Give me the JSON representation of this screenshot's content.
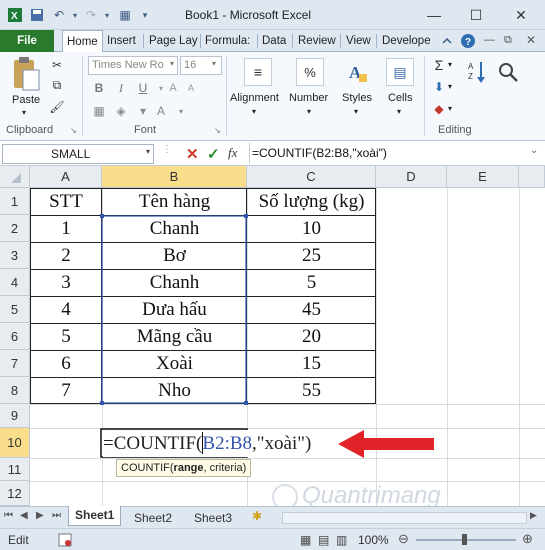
{
  "window": {
    "title": "Book1 - Microsoft Excel",
    "minimize": "—",
    "maximize": "☐",
    "close": "✕"
  },
  "tabs": [
    "File",
    "Home",
    "Insert",
    "Page Lay",
    "Formula:",
    "Data",
    "Review",
    "View",
    "Develope"
  ],
  "ribbon": {
    "paste_label": "Paste",
    "font_name": "Times New Ro",
    "font_size": "16",
    "alignment_label": "Alignment",
    "number_label": "Number",
    "styles_label": "Styles",
    "cells_label": "Cells",
    "clipboard_group": "Clipboard",
    "font_group": "Font",
    "editing_group": "Editing",
    "bold": "B",
    "italic": "I",
    "underline": "U",
    "sum": "Σ"
  },
  "formula_bar": {
    "name_box": "SMALL",
    "fx": "fx",
    "formula": "=COUNTIF(B2:B8,\"xoài\")"
  },
  "columns": [
    "A",
    "B",
    "C",
    "D",
    "E"
  ],
  "rows": [
    "1",
    "2",
    "3",
    "4",
    "5",
    "6",
    "7",
    "8",
    "9",
    "10",
    "11",
    "12"
  ],
  "table": {
    "headers": [
      "STT",
      "Tên hàng",
      "Số lượng (kg)"
    ],
    "rows": [
      [
        "1",
        "Chanh",
        "10"
      ],
      [
        "2",
        "Bơ",
        "25"
      ],
      [
        "3",
        "Chanh",
        "5"
      ],
      [
        "4",
        "Dưa hấu",
        "45"
      ],
      [
        "5",
        "Mãng cầu",
        "20"
      ],
      [
        "6",
        "Xoài",
        "15"
      ],
      [
        "7",
        "Nho",
        "55"
      ]
    ]
  },
  "edit_cell": {
    "prefix": "=COUNTIF(",
    "range": "B2:B8",
    "suffix": ",\"xoài\")"
  },
  "tooltip": {
    "func": "COUNTIF(",
    "arg1": "range",
    "rest": ", criteria)"
  },
  "sheets": [
    "Sheet1",
    "Sheet2",
    "Sheet3"
  ],
  "status": {
    "mode": "Edit",
    "zoom": "100%"
  },
  "watermark": "Quantrimang",
  "colors": {
    "file_tab": "#2a7a2e",
    "selection": "#3355aa",
    "arrow": "#e0242a",
    "header_selected": "#f9dd8b"
  }
}
